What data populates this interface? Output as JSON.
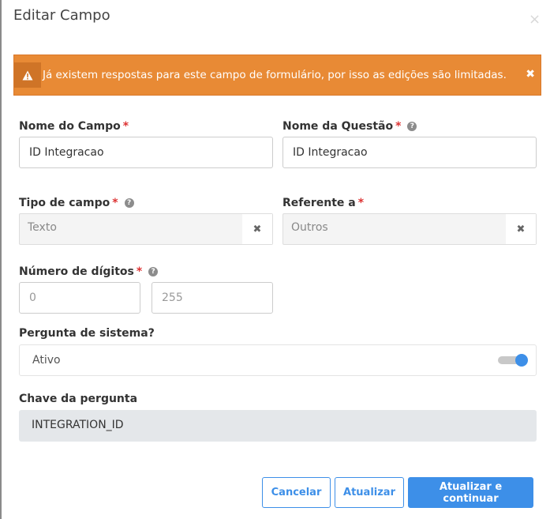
{
  "modal": {
    "title": "Editar Campo",
    "close_glyph": "×"
  },
  "alert": {
    "icon": "warning-triangle-icon",
    "message": "Já existem respostas para este campo de formulário, por isso as edições são limitadas.",
    "close_glyph": "✖",
    "color": "#e88a35"
  },
  "fields": {
    "nome_campo": {
      "label": "Nome do Campo",
      "required": "*",
      "value": "ID Integracao"
    },
    "nome_questao": {
      "label": "Nome da Questão",
      "required": "*",
      "help": "?",
      "value": "ID Integracao"
    },
    "tipo_campo": {
      "label": "Tipo de campo",
      "required": "*",
      "help": "?",
      "value": "Texto",
      "clear_glyph": "✖"
    },
    "referente": {
      "label": "Referente a",
      "required": "*",
      "value": "Outros",
      "clear_glyph": "✖"
    },
    "num_digitos": {
      "label": "Número de dígitos",
      "required": "*",
      "help": "?",
      "min_value": "0",
      "max_value": "255"
    },
    "pergunta_sistema": {
      "label": "Pergunta de sistema?",
      "status_text": "Ativo",
      "enabled": true
    },
    "chave": {
      "label": "Chave da pergunta",
      "value": "INTEGRATION_ID"
    }
  },
  "buttons": {
    "cancel": "Cancelar",
    "update": "Atualizar",
    "update_continue": "Atualizar e continuar"
  },
  "colors": {
    "primary": "#3d8fe8",
    "required": "#dd3333",
    "readonly_bg": "#e4e7ea"
  }
}
